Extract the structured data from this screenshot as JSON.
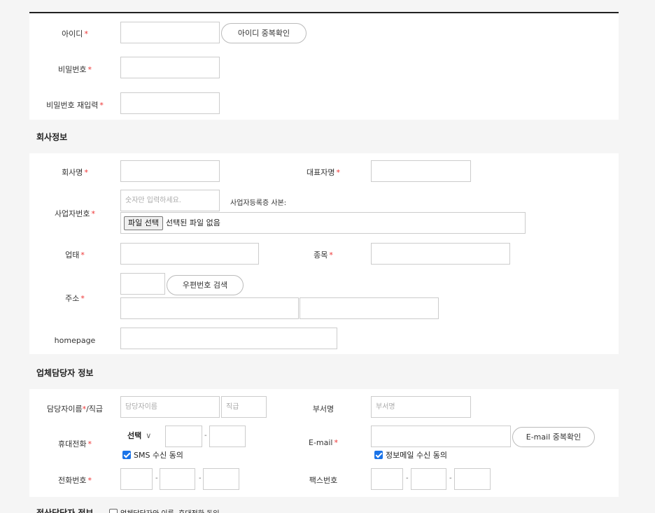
{
  "required_mark": "*",
  "account": {
    "id_label": "아이디",
    "id_check_button": "아이디 중복확인",
    "password_label": "비밀번호",
    "password_confirm_label": "비밀번호 재입력"
  },
  "company": {
    "section_title": "회사정보",
    "name_label": "회사명",
    "ceo_label": "대표자명",
    "bizno_label": "사업자번호",
    "bizno_placeholder": "숫자만 입력하세요.",
    "cert_label": "사업자등록증 사본:",
    "file_button": "파일 선택",
    "file_status": "선택된 파일 없음",
    "business_type_label": "업태",
    "business_item_label": "종목",
    "address_label": "주소",
    "postcode_button": "우편번호 검색",
    "homepage_label": "homepage"
  },
  "manager": {
    "section_title": "업체담당자 정보",
    "name_title_label": "담당자이름",
    "name_title_suffix": "/직급",
    "name_placeholder": "담당자이름",
    "title_placeholder": "직급",
    "dept_label": "부서명",
    "dept_placeholder": "부서명",
    "mobile_label": "휴대전화",
    "mobile_select": "선택",
    "sms_agree": "SMS 수신 동의",
    "email_label": "E-mail",
    "email_check_button": "E-mail 중복확인",
    "mail_agree": "정보메일 수신 동의",
    "phone_label": "전화번호",
    "fax_label": "팩스번호"
  },
  "settlement": {
    "section_title": "정산담당자 정보",
    "same_as_manager": "업체담당자와 이름, 휴대전화 동일"
  }
}
